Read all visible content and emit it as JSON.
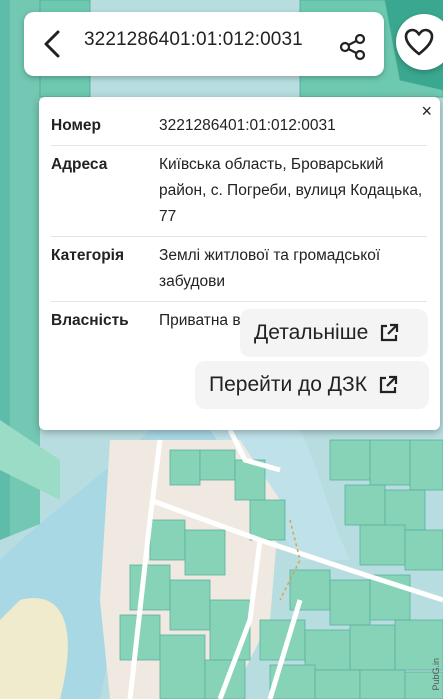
{
  "header": {
    "cadastral_number": "3221286401:01:012:0031",
    "back_icon": "arrow-back-icon",
    "share_icon": "share-icon",
    "favorite_icon": "heart-icon"
  },
  "popup": {
    "close_label": "×",
    "rows": [
      {
        "label": "Номер",
        "value": "3221286401:01:012:0031"
      },
      {
        "label": "Адреса",
        "value": "Київська область, Броварський район, с. Погреби, вулиця Кодацька, 77"
      },
      {
        "label": "Категорія",
        "value": "Землі житлової та громадської забудови"
      },
      {
        "label": "Власність",
        "value": "Приватна власність"
      }
    ],
    "details_label": "Детальніше",
    "dzk_label": "Перейти до ДЗК",
    "external_icon": "external-link-icon"
  },
  "map": {
    "attribution": "PubG.in",
    "colors": {
      "water": "#b8dde0",
      "parcel": "#86d3b8",
      "parcel_dark": "#3aa890",
      "road": "#ffffff",
      "ground": "#efe9e1"
    }
  }
}
